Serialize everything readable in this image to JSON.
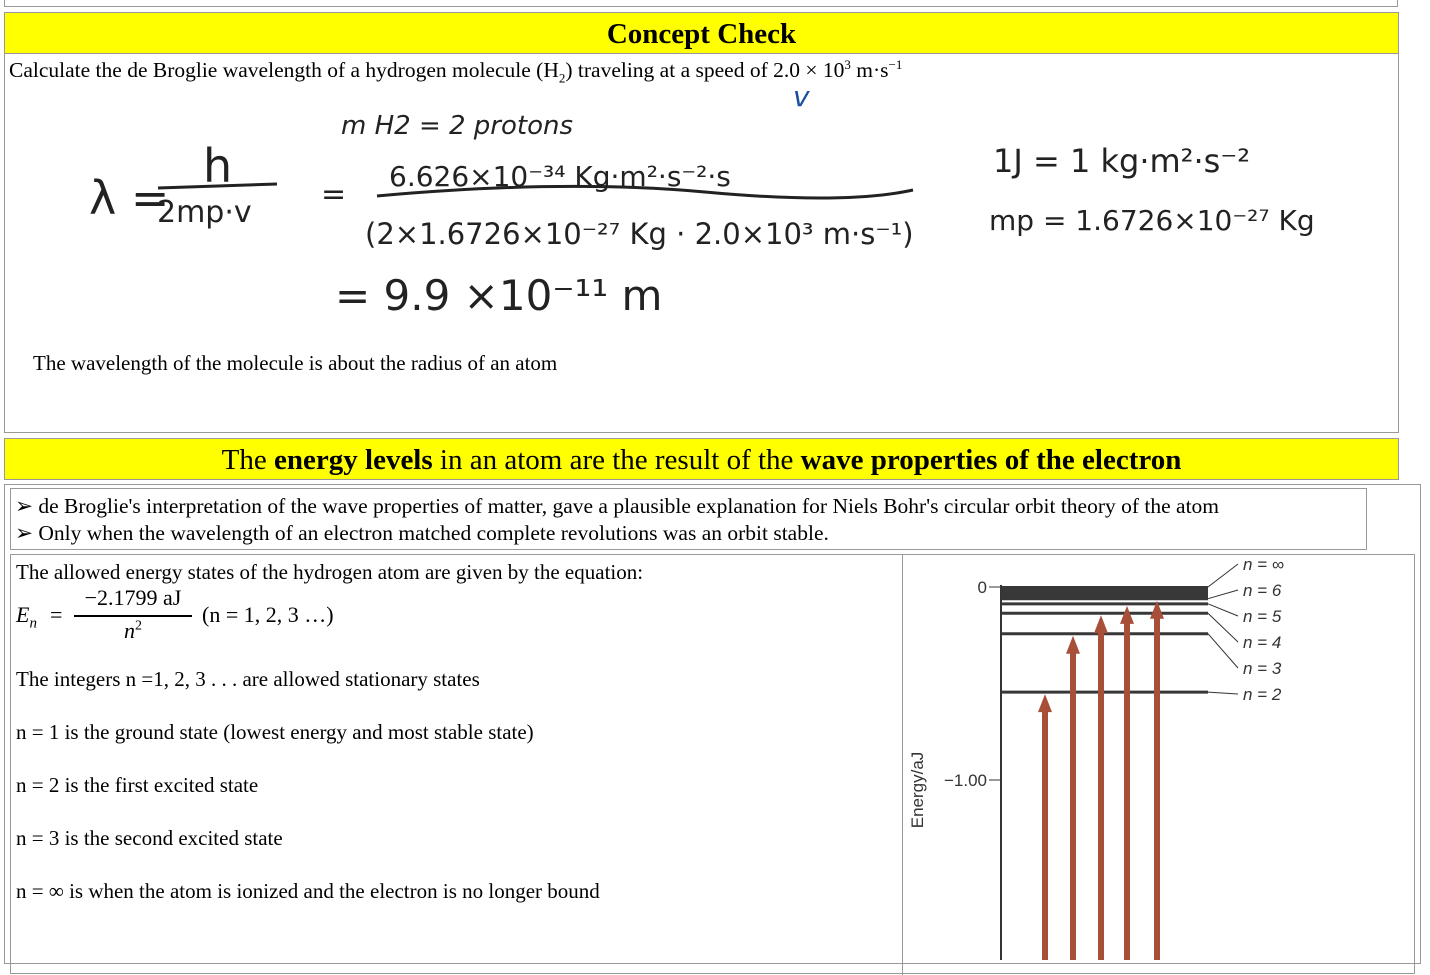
{
  "concept_check": {
    "title": "Concept Check",
    "question_prefix": "Calculate the de Broglie wavelength of a hydrogen molecule (H",
    "question_sub": "2",
    "question_suffix": ") traveling at a speed of 2.0 × 10",
    "question_exp": "3",
    "question_unit": " m·s",
    "question_unit_exp": "−1",
    "handwriting": {
      "v_label": "v",
      "mass_note": "m H2 = 2 protons",
      "lambda_lhs": "λ =",
      "lambda_num": "h",
      "lambda_den": "2mp·v",
      "equals": "=",
      "numerator": "6.626×10⁻³⁴ Kg·m²·s⁻²·s",
      "denominator": "(2×1.6726×10⁻²⁷ Kg · 2.0×10³ m·s⁻¹)",
      "result": "= 9.9 ×10⁻¹¹ m",
      "joule": "1J = 1 kg·m²·s⁻²",
      "proton_mass": "mp = 1.6726×10⁻²⁷ Kg"
    },
    "conclusion": "The wavelength of the molecule is about the radius of an atom"
  },
  "energy_section": {
    "title_parts": [
      "The ",
      "energy levels",
      " in an atom are the result of the ",
      "wave properties of the electron"
    ],
    "bullets": [
      "de Broglie's interpretation of the wave properties of matter, gave a plausible explanation for Niels Bohr's circular orbit theory of the atom",
      "Only when the wavelength of an electron matched complete revolutions was an orbit stable."
    ],
    "intro": "The allowed energy states of the hydrogen atom are given by the equation:",
    "equation": {
      "lhs": "E",
      "lhs_sub": "n",
      "eq": "=",
      "numerator": "−2.1799 aJ",
      "denominator": "n",
      "den_exp": "2",
      "condition": "(n = 1, 2, 3 …)"
    },
    "lines": [
      "The integers n =1, 2, 3 . . . are allowed stationary states",
      "n = 1 is the ground state (lowest energy and most stable state)",
      "n = 2 is the first excited state",
      "n = 3 is the second excited state",
      "n = ∞ is when the atom is ionized and the electron is no longer bound"
    ]
  },
  "chart_data": {
    "type": "energy-level diagram",
    "ylabel": "Energy/aJ",
    "yticks": [
      "0",
      "−1.00"
    ],
    "ytick_values": [
      0,
      -1.0
    ],
    "levels": [
      {
        "label": "n = ∞",
        "n": "inf",
        "energy": 0
      },
      {
        "label": "n = 6",
        "n": 6,
        "energy": -0.0606
      },
      {
        "label": "n = 5",
        "n": 5,
        "energy": -0.0872
      },
      {
        "label": "n = 4",
        "n": 4,
        "energy": -0.1362
      },
      {
        "label": "n = 3",
        "n": 3,
        "energy": -0.2422
      },
      {
        "label": "n = 2",
        "n": 2,
        "energy": -0.545
      }
    ],
    "transitions_to": [
      2,
      3,
      4,
      5,
      6
    ],
    "colors": {
      "arrow": "#a84f3a",
      "level": "#333333"
    }
  }
}
